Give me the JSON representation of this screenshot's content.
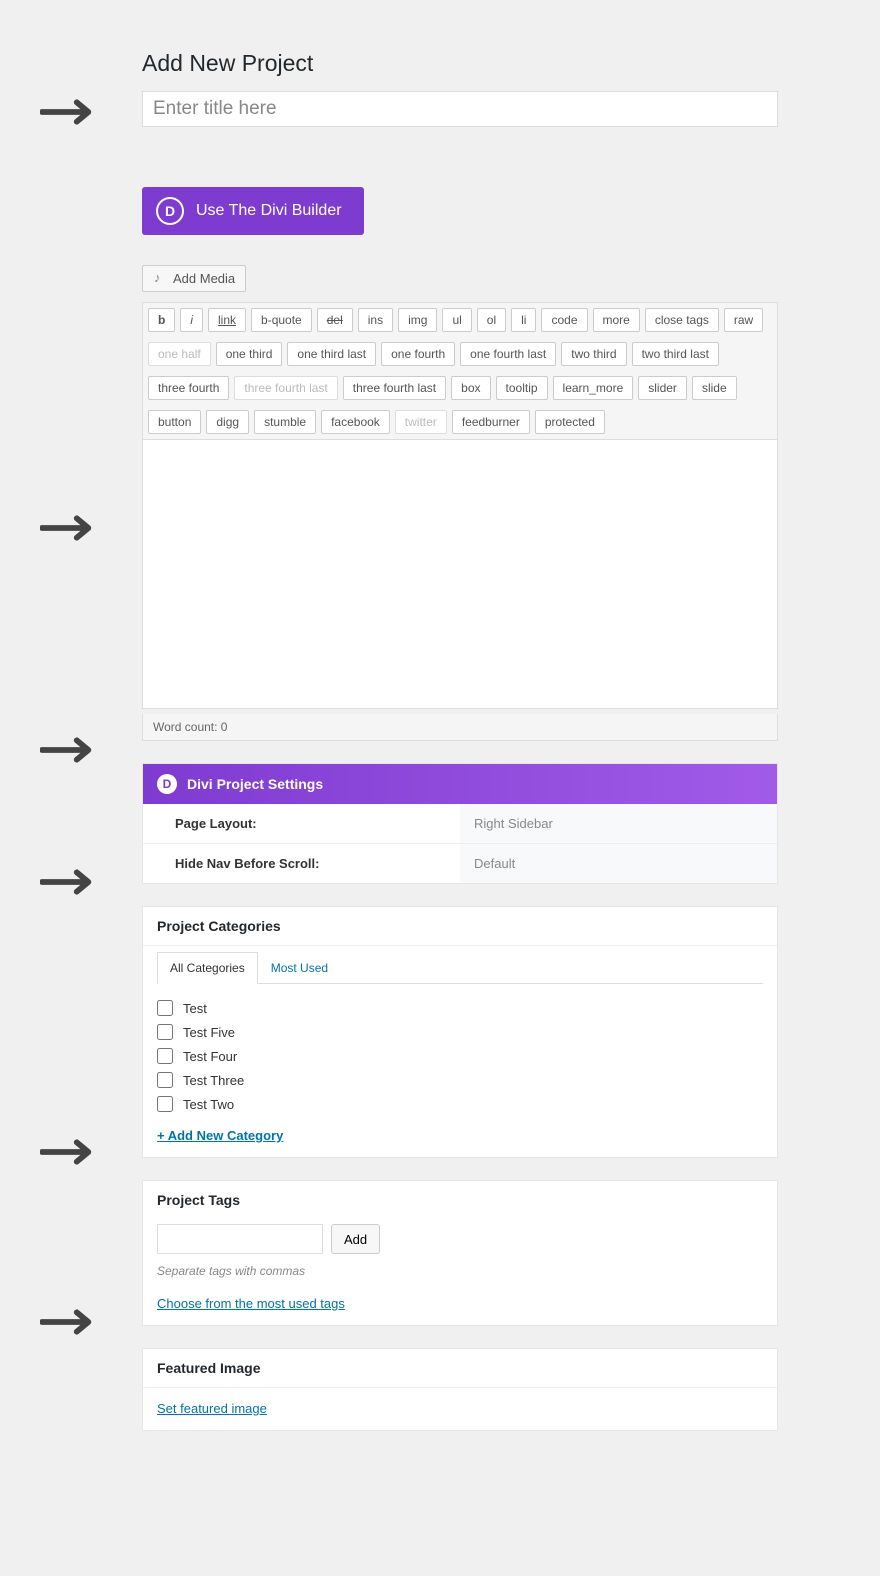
{
  "pageTitle": "Add New Project",
  "titlePlaceholder": "Enter title here",
  "diviButton": "Use The Divi Builder",
  "addMedia": "Add Media",
  "toolbar": {
    "row1": [
      "b",
      "i",
      "link",
      "b-quote",
      "del",
      "ins",
      "img",
      "ul",
      "ol",
      "li",
      "code",
      "more",
      "close tags",
      "raw",
      "one half"
    ],
    "row2": [
      "one third",
      "one third last",
      "one fourth",
      "one fourth last",
      "two third",
      "two third last",
      "three fourth",
      "three fourth last"
    ],
    "row3": [
      "three fourth last",
      "box",
      "tooltip",
      "learn_more",
      "slider",
      "slide",
      "button",
      "digg",
      "stumble",
      "facebook",
      "twitter"
    ],
    "row4": [
      "feedburner",
      "protected"
    ]
  },
  "wordCount": "Word count: 0",
  "diviSettings": {
    "title": "Divi Project Settings",
    "rows": [
      {
        "label": "Page Layout:",
        "value": "Right Sidebar"
      },
      {
        "label": "Hide Nav Before Scroll:",
        "value": "Default"
      }
    ]
  },
  "categories": {
    "title": "Project Categories",
    "tabs": {
      "all": "All Categories",
      "mostUsed": "Most Used"
    },
    "items": [
      "Test",
      "Test Five",
      "Test Four",
      "Test Three",
      "Test Two"
    ],
    "addNew": "+ Add New Category"
  },
  "tags": {
    "title": "Project Tags",
    "addBtn": "Add",
    "hint": "Separate tags with commas",
    "choose": "Choose from the most used tags"
  },
  "featured": {
    "title": "Featured Image",
    "setLink": "Set featured image"
  }
}
